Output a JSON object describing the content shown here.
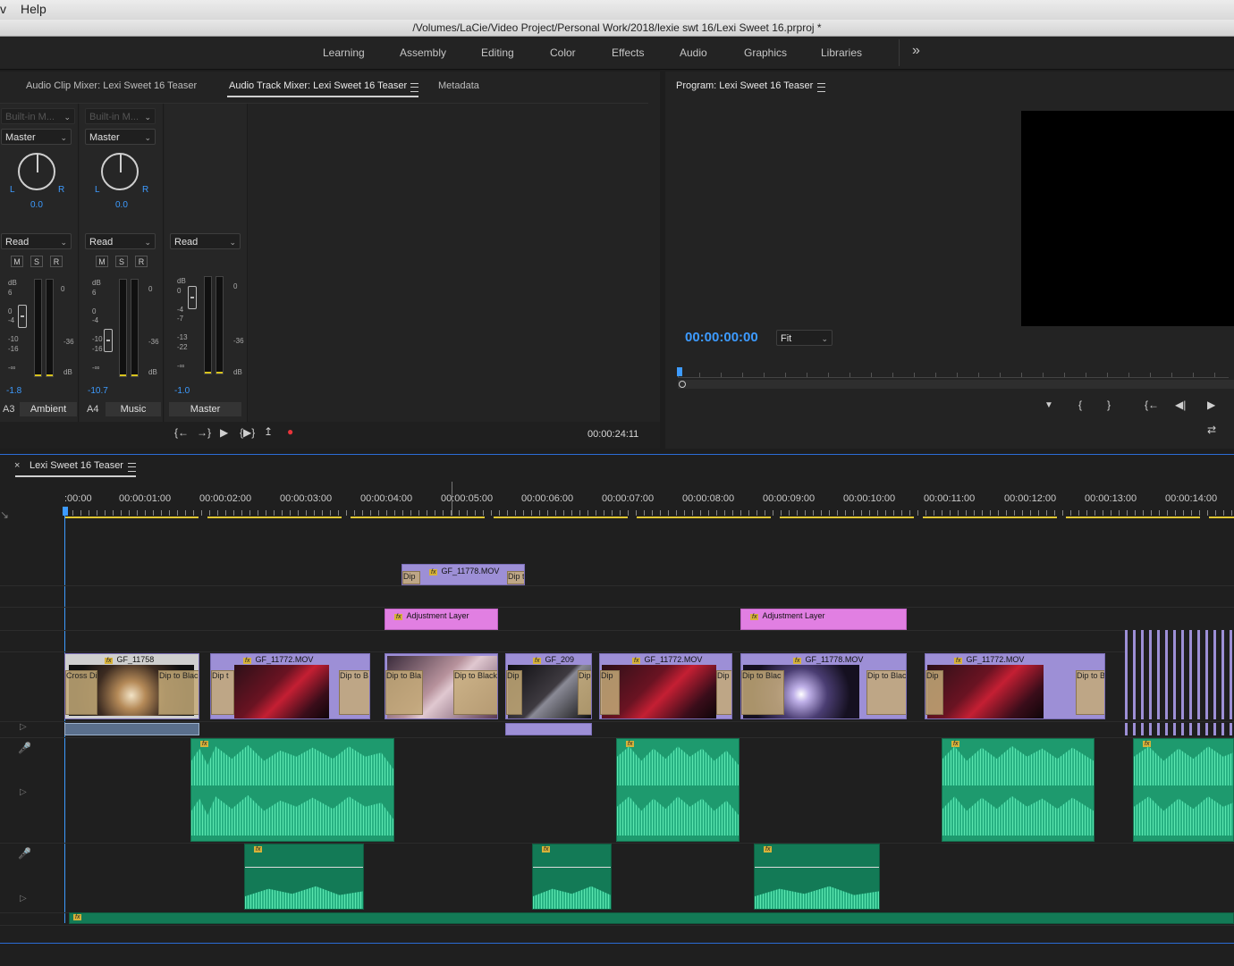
{
  "menubar": {
    "prev": "v",
    "help": "Help"
  },
  "window": {
    "title": "/Volumes/LaCie/Video Project/Personal Work/2018/lexie swt 16/Lexi Sweet 16.prproj *"
  },
  "workspaces": {
    "items": [
      "Learning",
      "Assembly",
      "Editing",
      "Color",
      "Effects",
      "Audio",
      "Graphics",
      "Libraries"
    ],
    "more": "»"
  },
  "mixer": {
    "tabs": [
      "Audio Clip Mixer: Lexi Sweet 16 Teaser",
      "Audio Track Mixer: Lexi Sweet 16 Teaser",
      "Metadata"
    ],
    "strips": [
      {
        "effect": "Built-in M...",
        "output": "Master",
        "pan": "0.0",
        "auto": "Read",
        "m": "M",
        "s": "S",
        "r": "R",
        "level": "-1.8",
        "track_id": "A3",
        "track_name": "Ambient",
        "scale_top": "0",
        "scale_mid": "-36",
        "db": "dB"
      },
      {
        "effect": "Built-in M...",
        "output": "Master",
        "pan": "0.0",
        "auto": "Read",
        "m": "M",
        "s": "S",
        "r": "R",
        "level": "-10.7",
        "track_id": "A4",
        "track_name": "Music",
        "scale_top": "0",
        "scale_mid": "-36",
        "db": "dB"
      },
      {
        "auto": "Read",
        "level": "-1.0",
        "track_name": "Master",
        "scale_top": "0",
        "scale_mid": "-36",
        "db": "dB"
      }
    ],
    "pan_l": "L",
    "pan_r": "R",
    "fader_scale_a": [
      "dB",
      "6",
      "0",
      "-4",
      "-10",
      "-16",
      "-∞"
    ],
    "fader_scale_master": [
      "dB",
      "0",
      "-4",
      "-7",
      "-13",
      "-22",
      "-∞"
    ],
    "timecode": "00:00:24:11",
    "transport": {
      "to_in": "{←",
      "to_out": "→}",
      "play": "▶",
      "loop": "{▶}",
      "export": "↥",
      "record": "●"
    }
  },
  "program": {
    "title": "Program: Lexi Sweet 16 Teaser",
    "timecode": "00:00:00:00",
    "zoom": "Fit",
    "controls": {
      "marker": "▼",
      "mark_in": "{",
      "mark_out": "}",
      "go_in": "{←",
      "step_back": "◀|",
      "play": "▶",
      "settings": "⇄"
    }
  },
  "timeline": {
    "tab": "Lexi Sweet 16 Teaser",
    "ruler": [
      ":00:00",
      "00:00:01:00",
      "00:00:02:00",
      "00:00:03:00",
      "00:00:04:00",
      "00:00:05:00",
      "00:00:06:00",
      "00:00:07:00",
      "00:00:08:00",
      "00:00:09:00",
      "00:00:10:00",
      "00:00:11:00",
      "00:00:12:00",
      "00:00:13:00",
      "00:00:14:00"
    ],
    "v4_clip": "GF_11778.MOV",
    "v4_dip_a": "Dip",
    "v4_dip_b": "Dip t",
    "adjustment": [
      "Adjustment Layer",
      "Adjustment Layer"
    ],
    "v1_clips": [
      "GF_11758",
      "GF_11772.MOV",
      "GF_209",
      "GF_11772.MOV",
      "GF_11778.MOV",
      "GF_11772.MOV"
    ],
    "transitions": [
      "Cross Di",
      "Dip to Blac",
      "Dip t",
      "Dip to B",
      "Dip to Bla",
      "Dip to Black",
      "Dip",
      "Dip",
      "Dip",
      "Dip",
      "Dip to Blac",
      "Dip to Blac",
      "Dip",
      "Dip to B"
    ],
    "fx": "fx"
  }
}
